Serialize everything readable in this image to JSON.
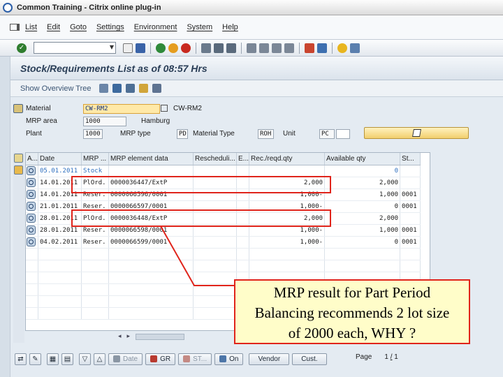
{
  "window": {
    "title": "Common Training - Citrix online plug-in"
  },
  "menu": [
    "List",
    "Edit",
    "Goto",
    "Settings",
    "Environment",
    "System",
    "Help"
  ],
  "page": {
    "title": "Stock/Requirements List as of 08:57 Hrs"
  },
  "app_toolbar": {
    "show_overview_tree": "Show Overview Tree"
  },
  "header": {
    "material_label": "Material",
    "material_value": "CW-RM2",
    "material_desc": "CW-RM2",
    "mrp_area_label": "MRP area",
    "mrp_area_value": "1000",
    "mrp_area_desc": "Hamburg",
    "plant_label": "Plant",
    "plant_value": "1000",
    "mrp_type_label": "MRP type",
    "mrp_type_value": "PD",
    "material_type_label": "Material Type",
    "material_type_value": "ROH",
    "unit_label": "Unit",
    "unit_value": "PC"
  },
  "grid": {
    "columns": [
      "A...",
      "Date",
      "MRP ...",
      "MRP element data",
      "Rescheduli...",
      "E...",
      "Rec./reqd.qty",
      "Available qty",
      "St..."
    ],
    "rows": [
      {
        "date": "05.01.2011",
        "mrp": "Stock",
        "element": "",
        "resched": "",
        "e": "",
        "qty": "",
        "avail": "0",
        "st": "",
        "blue": true
      },
      {
        "date": "14.01.2011",
        "mrp": "PlOrd.",
        "element": "0000036447/ExtP",
        "resched": "",
        "e": "",
        "qty": "2,000",
        "avail": "2,000",
        "st": "",
        "blue": false
      },
      {
        "date": "14.01.2011",
        "mrp": "Reser.",
        "element": "0000066596/0001",
        "resched": "",
        "e": "",
        "qty": "1,000-",
        "avail": "1,000",
        "st": "0001",
        "blue": false
      },
      {
        "date": "21.01.2011",
        "mrp": "Reser.",
        "element": "0000066597/0001",
        "resched": "",
        "e": "",
        "qty": "1,000-",
        "avail": "0",
        "st": "0001",
        "blue": false
      },
      {
        "date": "28.01.2011",
        "mrp": "PlOrd.",
        "element": "0000036448/ExtP",
        "resched": "",
        "e": "",
        "qty": "2,000",
        "avail": "2,000",
        "st": "",
        "blue": false
      },
      {
        "date": "28.01.2011",
        "mrp": "Reser.",
        "element": "0000066598/0001",
        "resched": "",
        "e": "",
        "qty": "1,000-",
        "avail": "1,000",
        "st": "0001",
        "blue": false
      },
      {
        "date": "04.02.2011",
        "mrp": "Reser.",
        "element": "0000066599/0001",
        "resched": "",
        "e": "",
        "qty": "1,000-",
        "avail": "0",
        "st": "0001",
        "blue": false
      }
    ]
  },
  "bottom_toolbar": {
    "date": "Date",
    "gr": "GR",
    "st": "ST...",
    "on": "On",
    "vendor": "Vendor",
    "cust": "Cust.",
    "page_label": "Page",
    "page_current": "1",
    "page_sep": "/",
    "page_total": "1"
  },
  "annotation": {
    "line1": "MRP result for Part Period",
    "line2": "Balancing recommends 2 lot size",
    "line3": "of 2000 each, WHY ?"
  },
  "colors": {
    "highlight": "#e0241b",
    "callout_bg": "#fffdc9",
    "input_bg": "#ffe9a8"
  }
}
